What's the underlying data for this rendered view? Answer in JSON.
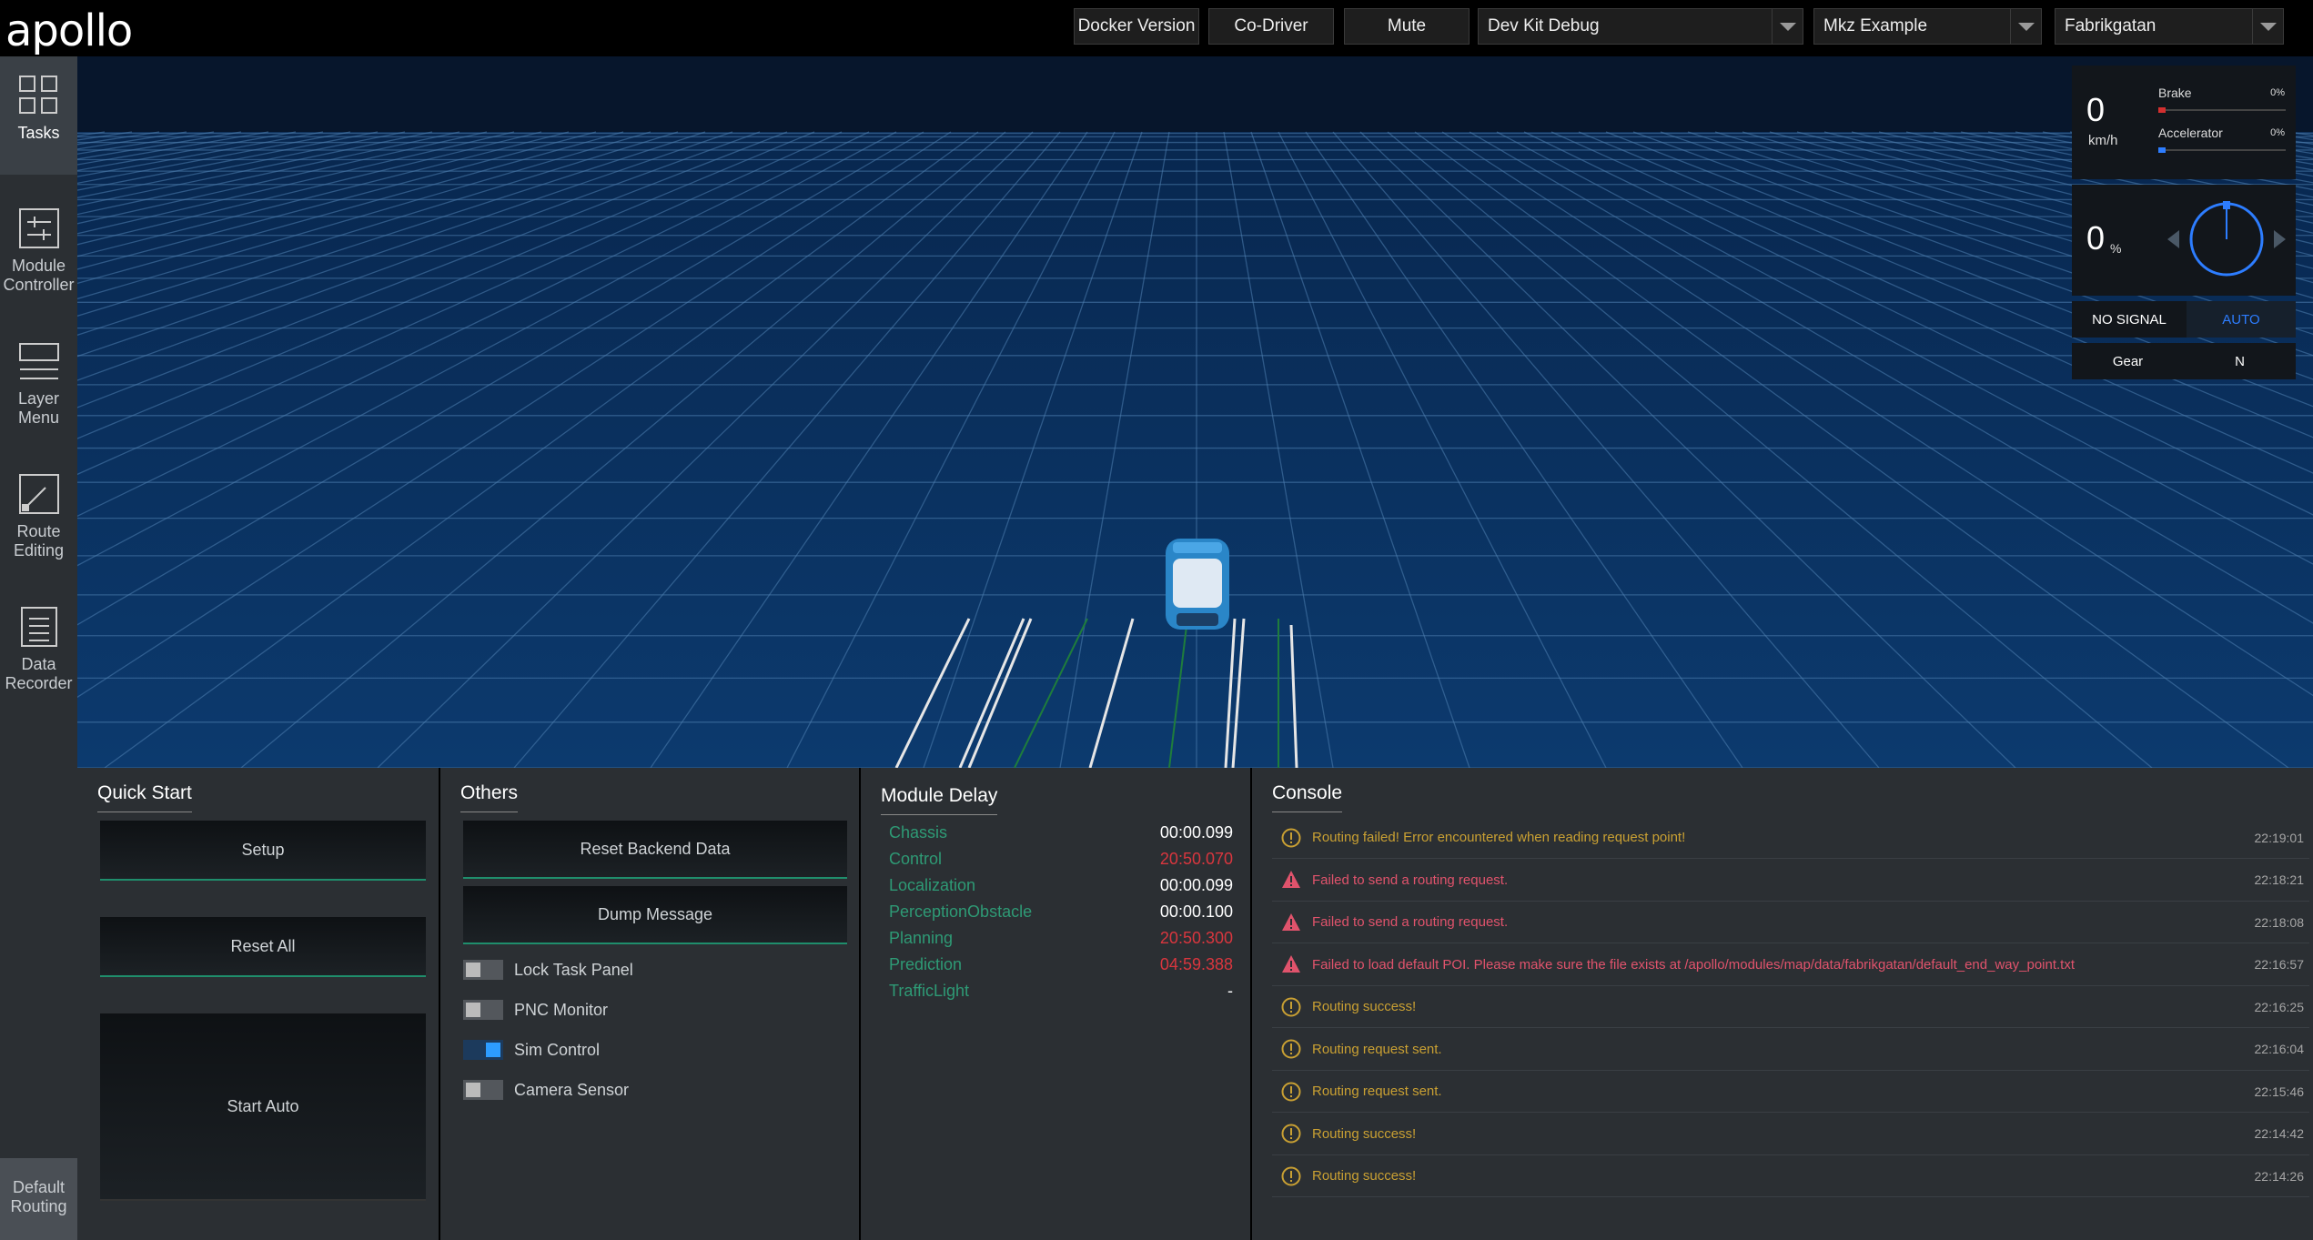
{
  "header": {
    "logo": "apollo",
    "buttons": [
      "Docker Version",
      "Co-Driver",
      "Mute"
    ],
    "selects": [
      "Dev Kit Debug",
      "Mkz Example",
      "Fabrikgatan"
    ]
  },
  "sidebar": {
    "items": [
      {
        "label1": "Tasks",
        "label2": ""
      },
      {
        "label1": "Module",
        "label2": "Controller"
      },
      {
        "label1": "Layer",
        "label2": "Menu"
      },
      {
        "label1": "Route",
        "label2": "Editing"
      },
      {
        "label1": "Data",
        "label2": "Recorder"
      }
    ],
    "bottom": {
      "label1": "Default",
      "label2": "Routing"
    }
  },
  "dashboard": {
    "speed": "0",
    "speed_unit": "km/h",
    "brake_label": "Brake",
    "brake_value": "0%",
    "accel_label": "Accelerator",
    "accel_value": "0%",
    "steering": "0",
    "steering_unit": "%",
    "signal": "NO SIGNAL",
    "mode": "AUTO",
    "gear_label": "Gear",
    "gear_value": "N",
    "colors": {
      "brake": "#d32f2f",
      "accel": "#2d7dff",
      "mode": "#2d7dff"
    }
  },
  "quick_start": {
    "title": "Quick Start",
    "buttons": [
      "Setup",
      "Reset All",
      "Start Auto"
    ]
  },
  "others": {
    "title": "Others",
    "buttons": [
      "Reset Backend Data",
      "Dump Message"
    ],
    "toggles": [
      {
        "label": "Lock Task Panel",
        "on": false
      },
      {
        "label": "PNC Monitor",
        "on": false
      },
      {
        "label": "Sim Control",
        "on": true
      },
      {
        "label": "Camera Sensor",
        "on": false
      }
    ]
  },
  "module_delay": {
    "title": "Module Delay",
    "rows": [
      {
        "name": "Chassis",
        "value": "00:00.099",
        "status": "ok"
      },
      {
        "name": "Control",
        "value": "20:50.070",
        "status": "warn"
      },
      {
        "name": "Localization",
        "value": "00:00.099",
        "status": "ok"
      },
      {
        "name": "PerceptionObstacle",
        "value": "00:00.100",
        "status": "ok"
      },
      {
        "name": "Planning",
        "value": "20:50.300",
        "status": "warn"
      },
      {
        "name": "Prediction",
        "value": "04:59.388",
        "status": "warn"
      },
      {
        "name": "TrafficLight",
        "value": "-",
        "status": "ok"
      }
    ]
  },
  "console": {
    "title": "Console",
    "rows": [
      {
        "type": "warn",
        "msg": "Routing failed! Error encountered when reading request point!",
        "time": "22:19:01"
      },
      {
        "type": "error",
        "msg": "Failed to send a routing request.",
        "time": "22:18:21"
      },
      {
        "type": "error",
        "msg": "Failed to send a routing request.",
        "time": "22:18:08"
      },
      {
        "type": "error",
        "msg": "Failed to load default POI. Please make sure the file exists at /apollo/modules/map/data/fabrikgatan/default_end_way_point.txt",
        "time": "22:16:57"
      },
      {
        "type": "warn",
        "msg": "Routing success!",
        "time": "22:16:25"
      },
      {
        "type": "warn",
        "msg": "Routing request sent.",
        "time": "22:16:04"
      },
      {
        "type": "warn",
        "msg": "Routing request sent.",
        "time": "22:15:46"
      },
      {
        "type": "warn",
        "msg": "Routing success!",
        "time": "22:14:42"
      },
      {
        "type": "warn",
        "msg": "Routing success!",
        "time": "22:14:26"
      }
    ]
  }
}
